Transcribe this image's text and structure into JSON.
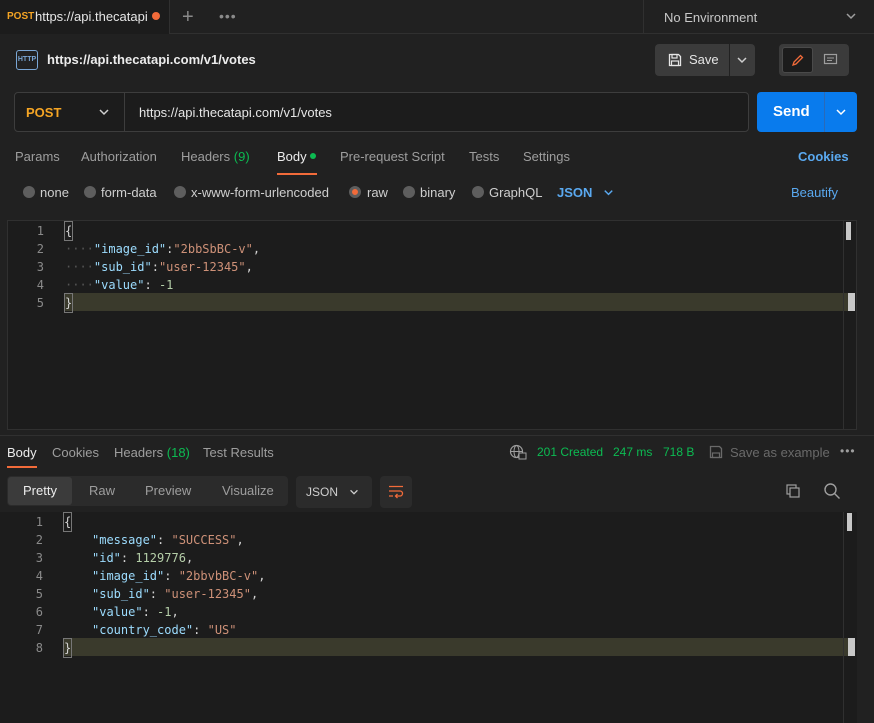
{
  "tab": {
    "method": "POST",
    "title": "https://api.thecatapi.c"
  },
  "environment": "No Environment",
  "request": {
    "title": "https://api.thecatapi.com/v1/votes",
    "http_icon": "HTTP",
    "save_label": "Save",
    "method": "POST",
    "url": "https://api.thecatapi.com/v1/votes",
    "send_label": "Send"
  },
  "request_tabs": {
    "params": "Params",
    "authorization": "Authorization",
    "headers": "Headers",
    "headers_count": "(9)",
    "body": "Body",
    "pre_request": "Pre-request Script",
    "tests": "Tests",
    "settings": "Settings",
    "cookies": "Cookies"
  },
  "body_types": {
    "none": "none",
    "form_data": "form-data",
    "urlencoded": "x-www-form-urlencoded",
    "raw": "raw",
    "binary": "binary",
    "graphql": "GraphQL",
    "format": "JSON",
    "beautify": "Beautify"
  },
  "request_body": {
    "line_numbers": [
      "1",
      "2",
      "3",
      "4",
      "5"
    ],
    "open_brace": "{",
    "close_brace": "}",
    "image_id_key": "\"image_id\"",
    "image_id_val": "\"2bbSbBC-v\"",
    "sub_id_key": "\"sub_id\"",
    "sub_id_val": "\"user-12345\"",
    "value_key": "\"value\"",
    "value_val": "-1"
  },
  "response_tabs": {
    "body": "Body",
    "cookies": "Cookies",
    "headers": "Headers",
    "headers_count": "(18)",
    "test_results": "Test Results"
  },
  "response_meta": {
    "status": "201 Created",
    "time": "247 ms",
    "size": "718 B",
    "save_example": "Save as example"
  },
  "view_tabs": {
    "pretty": "Pretty",
    "raw": "Raw",
    "preview": "Preview",
    "visualize": "Visualize",
    "format": "JSON"
  },
  "response_body": {
    "line_numbers": [
      "1",
      "2",
      "3",
      "4",
      "5",
      "6",
      "7",
      "8"
    ],
    "open_brace": "{",
    "close_brace": "}",
    "message_key": "\"message\"",
    "message_val": "\"SUCCESS\"",
    "id_key": "\"id\"",
    "id_val": "1129776",
    "image_id_key": "\"image_id\"",
    "image_id_val": "\"2bbvbBC-v\"",
    "sub_id_key": "\"sub_id\"",
    "sub_id_val": "\"user-12345\"",
    "value_key": "\"value\"",
    "value_val": "-1",
    "country_code_key": "\"country_code\"",
    "country_code_val": "\"US\""
  },
  "colors": {
    "accent": "#f26b3a",
    "send": "#097bed",
    "success": "#0cbb52",
    "post": "#f5a524",
    "link": "#5aa9f0"
  }
}
